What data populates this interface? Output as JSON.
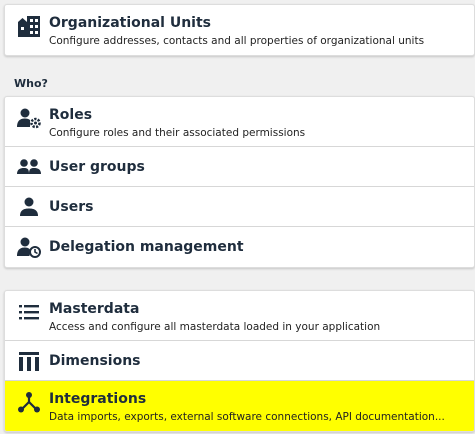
{
  "org_units": {
    "title": "Organizational Units",
    "description": "Configure addresses, contacts and all properties of organizational units",
    "icon": "building-icon"
  },
  "who_section": {
    "label": "Who?",
    "items": [
      {
        "title": "Roles",
        "description": "Configure roles and their associated permissions",
        "icon": "user-gear-icon"
      },
      {
        "title": "User groups",
        "icon": "user-group-icon"
      },
      {
        "title": "Users",
        "icon": "user-icon"
      },
      {
        "title": "Delegation management",
        "icon": "user-clock-icon"
      }
    ]
  },
  "data_section": {
    "items": [
      {
        "title": "Masterdata",
        "description": "Access and configure all masterdata loaded in your application",
        "icon": "list-icon"
      },
      {
        "title": "Dimensions",
        "icon": "dimensions-icon"
      },
      {
        "title": "Integrations",
        "description": "Data imports, exports, external software connections, API documentation...",
        "icon": "integration-icon"
      }
    ]
  },
  "colors": {
    "highlight": "#ffff00",
    "icon": "#1f2d3d"
  }
}
